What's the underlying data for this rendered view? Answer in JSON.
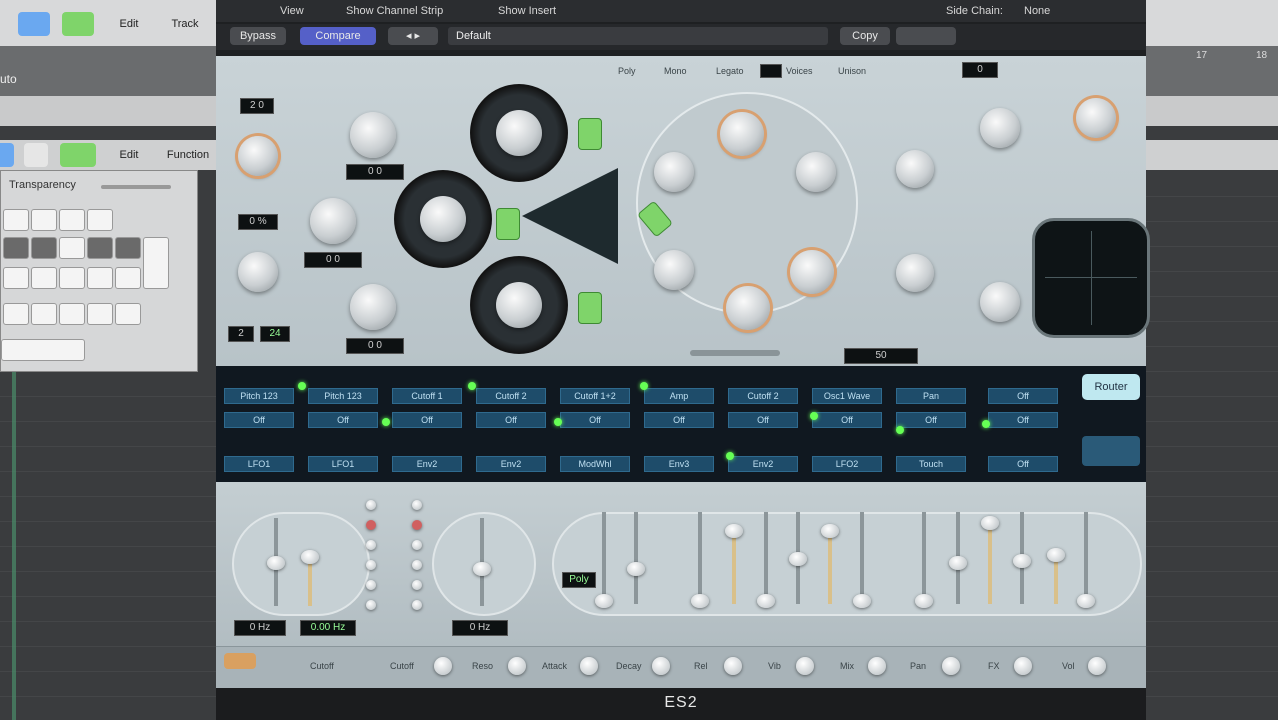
{
  "daw": {
    "toolbar_edit": "Edit",
    "toolbar_track": "Track",
    "toolbar_edit_2": "Edit",
    "toolbar_functions": "Function",
    "track_header": "uto",
    "transparency_label": "Transparency",
    "ruler_right": [
      "17",
      "18"
    ]
  },
  "plugin": {
    "header": {
      "view_label": "View",
      "channel_strip": "Show Channel Strip",
      "show_insert": "Show Insert",
      "side_chain": "Side Chain:",
      "side_chain_value": "None"
    },
    "toolbar": {
      "bypass": "Bypass",
      "compare": "Compare",
      "preset": "Default",
      "copy": "Copy"
    },
    "top_labels": [
      "Poly",
      "Mono",
      "Legato",
      "Voices",
      "Unison"
    ],
    "glide_value": "0",
    "osc_lcds": [
      "0 0",
      "0 0",
      "0 0"
    ],
    "left_lcds": [
      "2 0",
      "0 %",
      "2",
      "24"
    ],
    "mix_lcd": "50",
    "router_button": "Router",
    "matrix": {
      "columns": [
        {
          "target": "Pitch 123",
          "via": "Off",
          "source": "LFO1"
        },
        {
          "target": "Pitch 123",
          "via": "Off",
          "source": "LFO1"
        },
        {
          "target": "Cutoff 1",
          "via": "Off",
          "source": "Env2"
        },
        {
          "target": "Cutoff 2",
          "via": "Off",
          "source": "Env2"
        },
        {
          "target": "Cutoff 1+2",
          "via": "Off",
          "source": "ModWhl"
        },
        {
          "target": "Amp",
          "via": "Off",
          "source": "Env3"
        },
        {
          "target": "Cutoff 2",
          "via": "Off",
          "source": "Env2"
        },
        {
          "target": "Osc1 Wave",
          "via": "Off",
          "source": "LFO2"
        },
        {
          "target": "Pan",
          "via": "Off",
          "source": "Touch"
        },
        {
          "target": "Off",
          "via": "Off",
          "source": "Off"
        }
      ]
    },
    "env": {
      "lfo_lcds": [
        "0 Hz",
        "0.00 Hz",
        "0 Hz"
      ],
      "env_badge": "Poly"
    },
    "macro": {
      "label_main": "Cutoff",
      "labels": [
        "Cutoff",
        "Reso",
        "Attack",
        "Decay",
        "Rel",
        "Vib",
        "Mix",
        "Pan",
        "FX",
        "Vol"
      ]
    },
    "footer_title": "ES2"
  }
}
